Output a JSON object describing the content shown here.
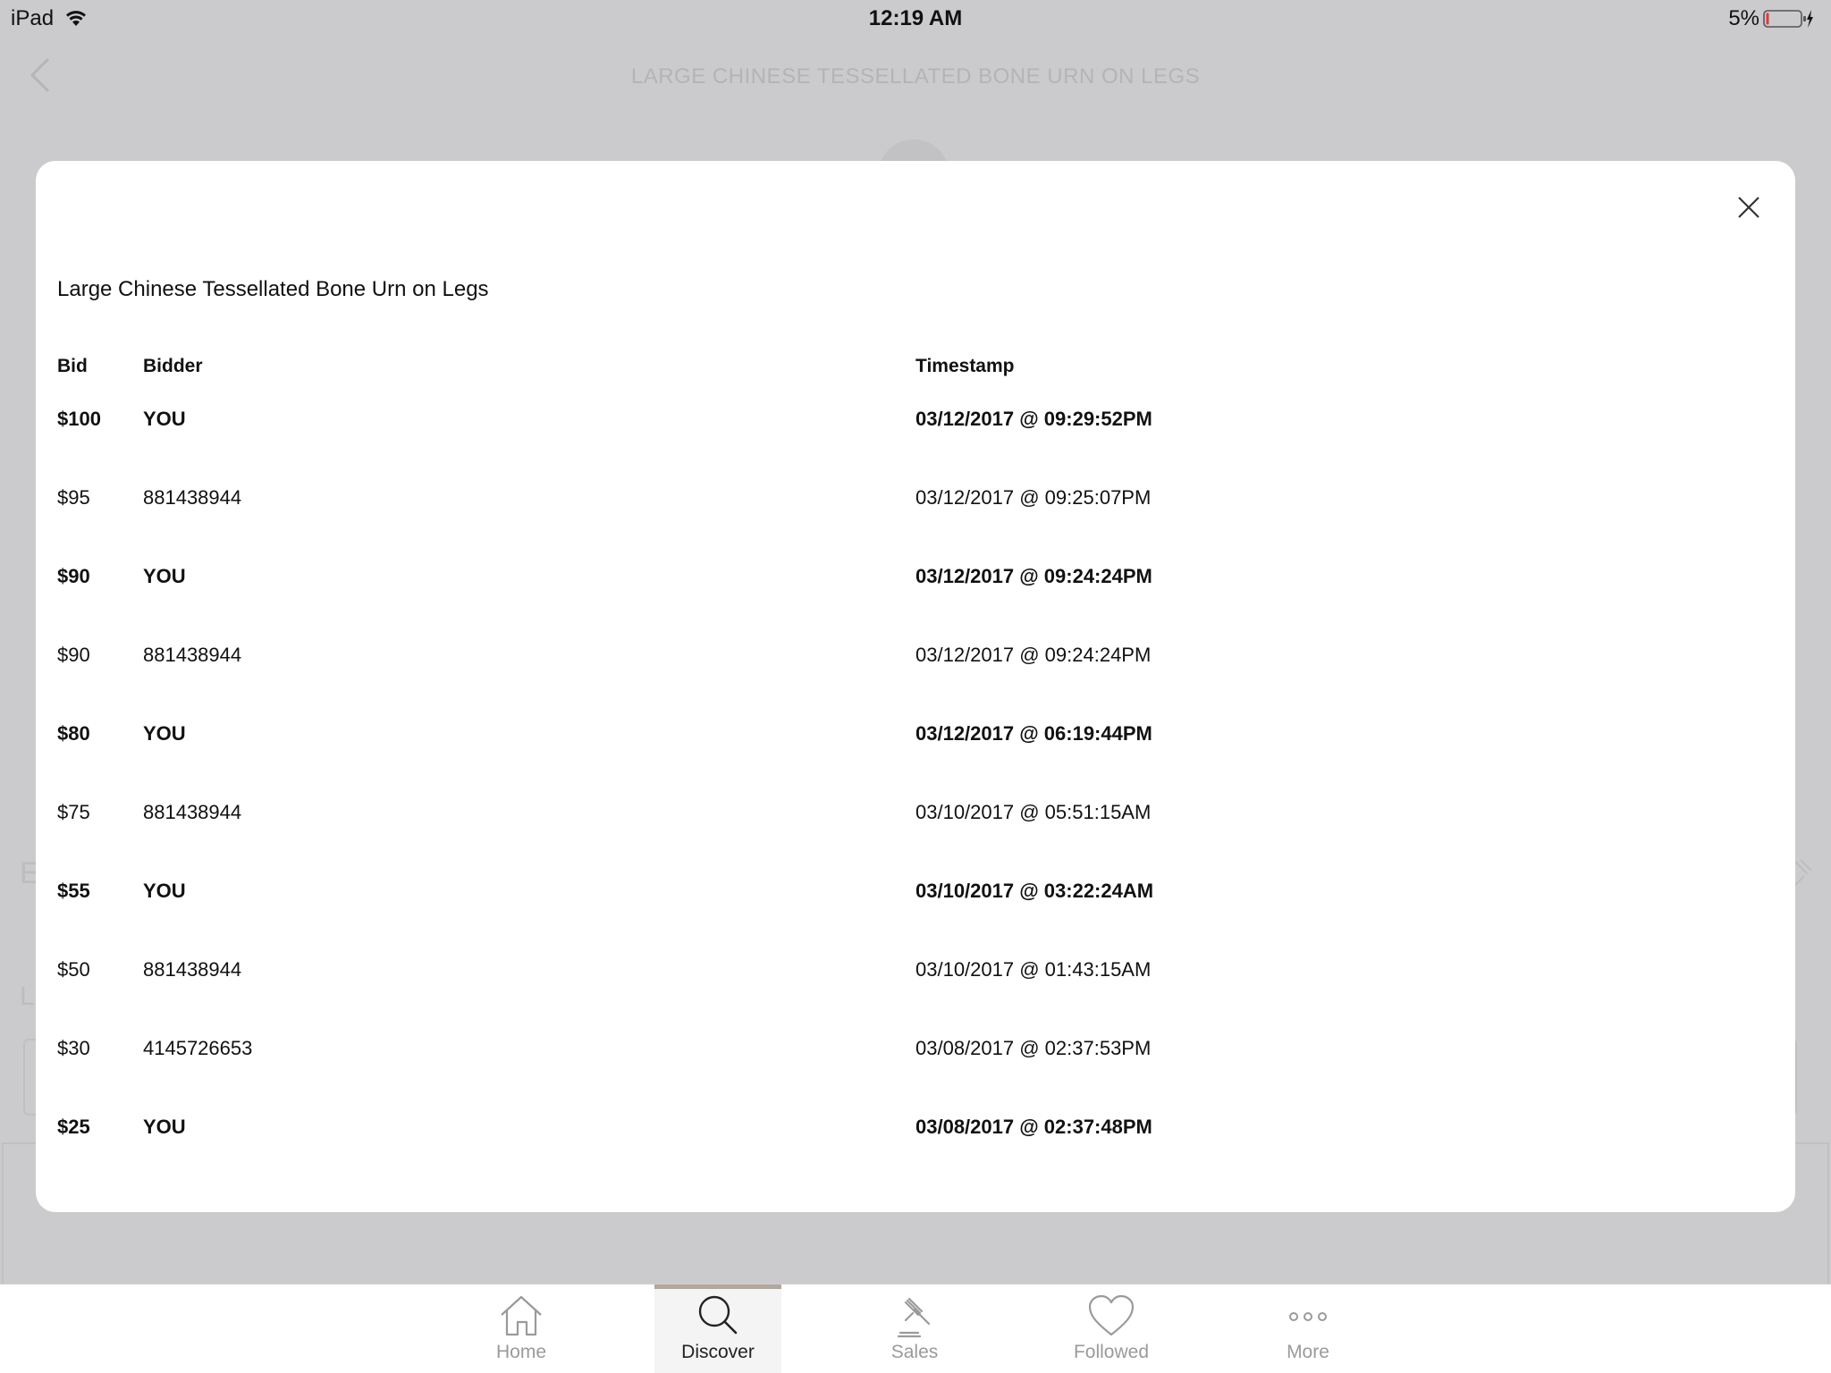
{
  "status_bar": {
    "device": "iPad",
    "time": "12:19 AM",
    "battery": "5%"
  },
  "background": {
    "page_title": "LARGE CHINESE TESSELLATED BONE URN ON LEGS",
    "fragment_e": "E",
    "fragment_l": "L"
  },
  "modal": {
    "title": "Large Chinese Tessellated Bone Urn on Legs",
    "columns": {
      "bid": "Bid",
      "bidder": "Bidder",
      "timestamp": "Timestamp"
    },
    "rows": [
      {
        "bid": "$100",
        "bidder": "YOU",
        "timestamp": "03/12/2017 @ 09:29:52PM"
      },
      {
        "bid": "$95",
        "bidder": "881438944",
        "timestamp": "03/12/2017 @ 09:25:07PM"
      },
      {
        "bid": "$90",
        "bidder": "YOU",
        "timestamp": "03/12/2017 @ 09:24:24PM"
      },
      {
        "bid": "$90",
        "bidder": "881438944",
        "timestamp": "03/12/2017 @ 09:24:24PM"
      },
      {
        "bid": "$80",
        "bidder": "YOU",
        "timestamp": "03/12/2017 @ 06:19:44PM"
      },
      {
        "bid": "$75",
        "bidder": "881438944",
        "timestamp": "03/10/2017 @ 05:51:15AM"
      },
      {
        "bid": "$55",
        "bidder": "YOU",
        "timestamp": "03/10/2017 @ 03:22:24AM"
      },
      {
        "bid": "$50",
        "bidder": "881438944",
        "timestamp": "03/10/2017 @ 01:43:15AM"
      },
      {
        "bid": "$30",
        "bidder": "4145726653",
        "timestamp": "03/08/2017 @ 02:37:53PM"
      },
      {
        "bid": "$25",
        "bidder": "YOU",
        "timestamp": "03/08/2017 @ 02:37:48PM"
      }
    ]
  },
  "tab_bar": {
    "tabs": [
      {
        "label": "Home",
        "icon": "home-icon"
      },
      {
        "label": "Discover",
        "icon": "search-icon",
        "active": true
      },
      {
        "label": "Sales",
        "icon": "gavel-icon"
      },
      {
        "label": "Followed",
        "icon": "heart-icon"
      },
      {
        "label": "More",
        "icon": "more-dots-icon"
      }
    ]
  },
  "colors": {
    "overlay": "#cbcbcd",
    "modal_bg": "#ffffff",
    "tab_active_indicator": "#b3a79e",
    "tab_inactive": "#9a9a9a",
    "battery_low": "#e53935"
  }
}
